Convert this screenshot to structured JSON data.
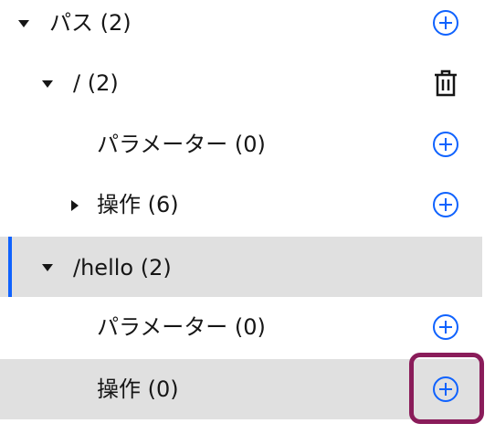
{
  "tree": {
    "paths_label": "パス (2)",
    "root_path_label": "/ (2)",
    "root_params_label": "パラメーター (0)",
    "root_ops_label": "操作 (6)",
    "hello_path_label": "/hello (2)",
    "hello_params_label": "パラメーター (0)",
    "hello_ops_label": "操作 (0)"
  },
  "colors": {
    "accent": "#0f62fe",
    "highlight": "#8a1c5a",
    "selected_bg": "#e0e0e0"
  },
  "icons": {
    "add": "add-circle-icon",
    "delete": "trash-icon",
    "expanded": "caret-down-icon",
    "collapsed": "caret-right-icon"
  }
}
